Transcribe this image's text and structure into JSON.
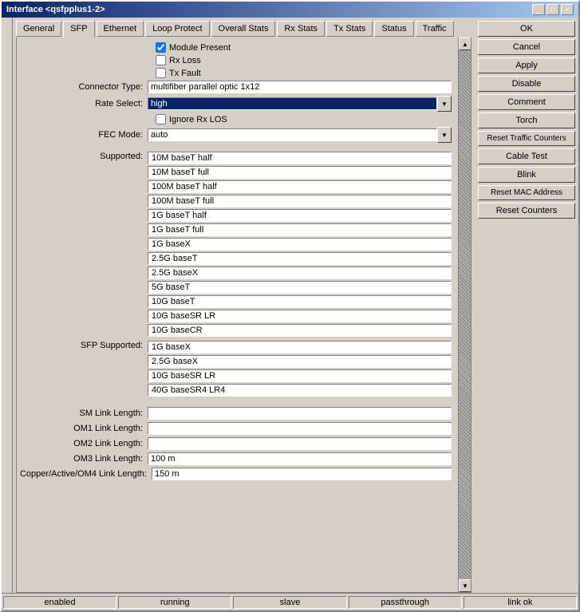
{
  "window": {
    "title": "Interface <qsfpplus1-2>"
  },
  "tabs": [
    {
      "label": "General",
      "active": false
    },
    {
      "label": "SFP",
      "active": true
    },
    {
      "label": "Ethernet",
      "active": false
    },
    {
      "label": "Loop Protect",
      "active": false
    },
    {
      "label": "Overall Stats",
      "active": false
    },
    {
      "label": "Rx Stats",
      "active": false
    },
    {
      "label": "Tx Stats",
      "active": false
    },
    {
      "label": "Status",
      "active": false
    },
    {
      "label": "Traffic",
      "active": false
    }
  ],
  "checkboxes": {
    "module_present": {
      "label": "Module Present",
      "checked": true
    },
    "rx_loss": {
      "label": "Rx Loss",
      "checked": false
    },
    "tx_fault": {
      "label": "Tx Fault",
      "checked": false
    },
    "ignore_rx_los": {
      "label": "Ignore Rx LOS",
      "checked": false
    }
  },
  "fields": {
    "connector_type": {
      "label": "Connector Type:",
      "value": "multifiber parallel optic 1x12"
    },
    "rate_select": {
      "label": "Rate Select:",
      "value": "high"
    },
    "fec_mode": {
      "label": "FEC Mode:",
      "value": "auto"
    }
  },
  "supported_list": {
    "label": "Supported:",
    "items": [
      "10M baseT half",
      "10M baseT full",
      "100M baseT half",
      "100M baseT full",
      "1G baseT half",
      "1G baseT full",
      "1G baseX",
      "2.5G baseT",
      "2.5G baseX",
      "5G baseT",
      "10G baseT",
      "10G baseSR LR",
      "10G baseCR"
    ]
  },
  "sfp_supported_list": {
    "label": "SFP Supported:",
    "items": [
      "1G baseX",
      "2.5G baseX",
      "10G baseSR LR",
      "40G baseSR4 LR4"
    ]
  },
  "link_lengths": {
    "sm": {
      "label": "SM Link Length:",
      "value": ""
    },
    "om1": {
      "label": "OM1 Link Length:",
      "value": ""
    },
    "om2": {
      "label": "OM2 Link Length:",
      "value": ""
    },
    "om3": {
      "label": "OM3 Link Length:",
      "value": "100 m"
    },
    "copper_om4": {
      "label": "Copper/Active/OM4 Link Length:",
      "value": "150 m"
    }
  },
  "buttons": {
    "ok": "OK",
    "cancel": "Cancel",
    "apply": "Apply",
    "disable": "Disable",
    "comment": "Comment",
    "torch": "Torch",
    "reset_traffic": "Reset Traffic Counters",
    "cable_test": "Cable Test",
    "blink": "Blink",
    "reset_mac": "Reset MAC Address",
    "reset_counters": "Reset Counters"
  },
  "status_bar": {
    "enabled": "enabled",
    "running": "running",
    "slave": "slave",
    "passthrough": "passthrough",
    "link_ok": "link ok"
  }
}
